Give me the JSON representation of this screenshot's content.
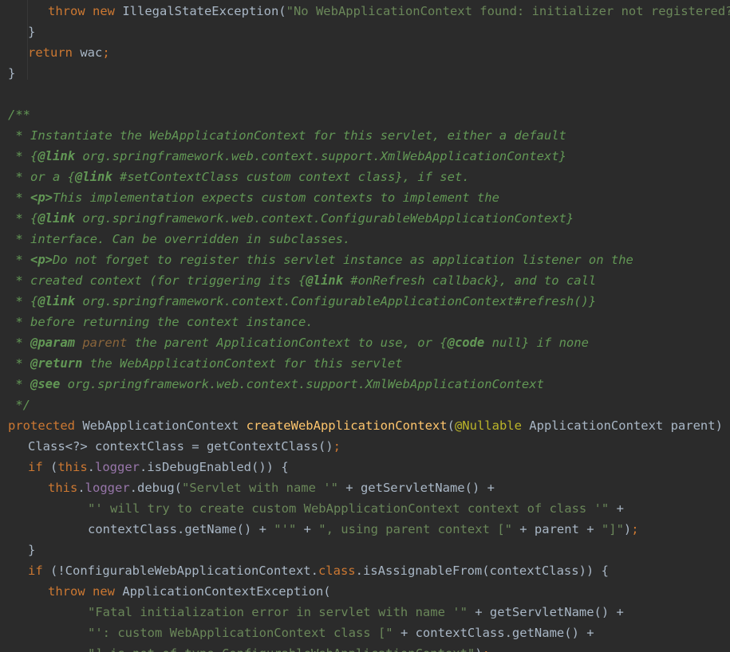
{
  "editor": {
    "language": "Java",
    "theme_colors": {
      "background": "#2b2b2b",
      "keyword": "#cc7832",
      "plain": "#a9b7c6",
      "string": "#6a8759",
      "method_declaration": "#ffc66d",
      "field": "#9876aa",
      "annotation": "#bbb529",
      "doc_comment": "#629755",
      "doc_param": "#8a653b"
    },
    "lines": [
      {
        "indent": 2,
        "tokens": [
          {
            "t": "kw",
            "v": "throw new "
          },
          {
            "t": "plain",
            "v": "IllegalStateException("
          },
          {
            "t": "str",
            "v": "\"No WebApplicationContext found: initializer not registered?\""
          },
          {
            "t": "plain",
            "v": ");"
          }
        ]
      },
      {
        "indent": 1,
        "tokens": [
          {
            "t": "plain",
            "v": "}"
          }
        ]
      },
      {
        "indent": 1,
        "tokens": [
          {
            "t": "kw",
            "v": "return "
          },
          {
            "t": "plain",
            "v": "wac"
          },
          {
            "t": "kw",
            "v": ";"
          }
        ]
      },
      {
        "indent": 0,
        "tokens": [
          {
            "t": "plain",
            "v": "}"
          }
        ]
      },
      {
        "indent": 0,
        "tokens": []
      },
      {
        "indent": 0,
        "tokens": [
          {
            "t": "doc",
            "v": "/**"
          }
        ]
      },
      {
        "indent": 0,
        "tokens": [
          {
            "t": "doc",
            "v": " * Instantiate the WebApplicationContext for this servlet, either a default"
          }
        ]
      },
      {
        "indent": 0,
        "tokens": [
          {
            "t": "doc",
            "v": " * {"
          },
          {
            "t": "doctag",
            "v": "@link"
          },
          {
            "t": "doclink",
            "v": " org.springframework.web.context.support.XmlWebApplicationContext}"
          }
        ]
      },
      {
        "indent": 0,
        "tokens": [
          {
            "t": "doc",
            "v": " * or a {"
          },
          {
            "t": "doctag",
            "v": "@link"
          },
          {
            "t": "doc",
            "v": " #setContextClass custom context class}, if set."
          }
        ]
      },
      {
        "indent": 0,
        "tokens": [
          {
            "t": "doc",
            "v": " * "
          },
          {
            "t": "doctag",
            "v": "<p>"
          },
          {
            "t": "doc",
            "v": "This implementation expects custom contexts to implement the"
          }
        ]
      },
      {
        "indent": 0,
        "tokens": [
          {
            "t": "doc",
            "v": " * {"
          },
          {
            "t": "doctag",
            "v": "@link"
          },
          {
            "t": "doclink",
            "v": " org.springframework.web.context.ConfigurableWebApplicationContext}"
          }
        ]
      },
      {
        "indent": 0,
        "tokens": [
          {
            "t": "doc",
            "v": " * interface. Can be overridden in subclasses."
          }
        ]
      },
      {
        "indent": 0,
        "tokens": [
          {
            "t": "doc",
            "v": " * "
          },
          {
            "t": "doctag",
            "v": "<p>"
          },
          {
            "t": "doc",
            "v": "Do not forget to register this servlet instance as application listener on the"
          }
        ]
      },
      {
        "indent": 0,
        "tokens": [
          {
            "t": "doc",
            "v": " * created context (for triggering its {"
          },
          {
            "t": "doctag",
            "v": "@link"
          },
          {
            "t": "doc",
            "v": " #onRefresh callback}, and to call"
          }
        ]
      },
      {
        "indent": 0,
        "tokens": [
          {
            "t": "doc",
            "v": " * {"
          },
          {
            "t": "doctag",
            "v": "@link"
          },
          {
            "t": "doclink",
            "v": " org.springframework.context.ConfigurableApplicationContext#refresh()}"
          }
        ]
      },
      {
        "indent": 0,
        "tokens": [
          {
            "t": "doc",
            "v": " * before returning the context instance."
          }
        ]
      },
      {
        "indent": 0,
        "tokens": [
          {
            "t": "doc",
            "v": " * "
          },
          {
            "t": "doctag",
            "v": "@param"
          },
          {
            "t": "docparam",
            "v": " parent"
          },
          {
            "t": "doc",
            "v": " the parent ApplicationContext to use, or {"
          },
          {
            "t": "doctag",
            "v": "@code"
          },
          {
            "t": "doc",
            "v": " null} if none"
          }
        ]
      },
      {
        "indent": 0,
        "tokens": [
          {
            "t": "doc",
            "v": " * "
          },
          {
            "t": "doctag",
            "v": "@return"
          },
          {
            "t": "doc",
            "v": " the WebApplicationContext for this servlet"
          }
        ]
      },
      {
        "indent": 0,
        "tokens": [
          {
            "t": "doc",
            "v": " * "
          },
          {
            "t": "doctag",
            "v": "@see"
          },
          {
            "t": "doclink",
            "v": " org.springframework.web.context.support.XmlWebApplicationContext"
          }
        ]
      },
      {
        "indent": 0,
        "tokens": [
          {
            "t": "doc",
            "v": " */"
          }
        ]
      },
      {
        "indent": 0,
        "tokens": [
          {
            "t": "kw",
            "v": "protected "
          },
          {
            "t": "plain",
            "v": "WebApplicationContext "
          },
          {
            "t": "fn",
            "v": "createWebApplicationContext"
          },
          {
            "t": "plain",
            "v": "("
          },
          {
            "t": "ann",
            "v": "@Nullable "
          },
          {
            "t": "plain",
            "v": "ApplicationContext parent) {"
          }
        ]
      },
      {
        "indent": 1,
        "tokens": [
          {
            "t": "plain",
            "v": "Class<?> contextClass = getContextClass()"
          },
          {
            "t": "kw",
            "v": ";"
          }
        ]
      },
      {
        "indent": 1,
        "tokens": [
          {
            "t": "kw",
            "v": "if "
          },
          {
            "t": "plain",
            "v": "("
          },
          {
            "t": "kw",
            "v": "this"
          },
          {
            "t": "plain",
            "v": "."
          },
          {
            "t": "field",
            "v": "logger"
          },
          {
            "t": "plain",
            "v": ".isDebugEnabled()) {"
          }
        ]
      },
      {
        "indent": 2,
        "tokens": [
          {
            "t": "kw",
            "v": "this"
          },
          {
            "t": "plain",
            "v": "."
          },
          {
            "t": "field",
            "v": "logger"
          },
          {
            "t": "plain",
            "v": ".debug("
          },
          {
            "t": "str",
            "v": "\"Servlet with name '\""
          },
          {
            "t": "plain",
            "v": " + getServletName() +"
          }
        ]
      },
      {
        "indent": 4,
        "tokens": [
          {
            "t": "str",
            "v": "\"' will try to create custom WebApplicationContext context of class '\""
          },
          {
            "t": "plain",
            "v": " +"
          }
        ]
      },
      {
        "indent": 4,
        "tokens": [
          {
            "t": "plain",
            "v": "contextClass.getName() + "
          },
          {
            "t": "str",
            "v": "\"'\""
          },
          {
            "t": "plain",
            "v": " + "
          },
          {
            "t": "str",
            "v": "\", using parent context [\""
          },
          {
            "t": "plain",
            "v": " + parent + "
          },
          {
            "t": "str",
            "v": "\"]\""
          },
          {
            "t": "plain",
            "v": ")"
          },
          {
            "t": "kw",
            "v": ";"
          }
        ]
      },
      {
        "indent": 1,
        "tokens": [
          {
            "t": "plain",
            "v": "}"
          }
        ]
      },
      {
        "indent": 1,
        "tokens": [
          {
            "t": "kw",
            "v": "if "
          },
          {
            "t": "plain",
            "v": "(!ConfigurableWebApplicationContext."
          },
          {
            "t": "kw",
            "v": "class"
          },
          {
            "t": "plain",
            "v": ".isAssignableFrom(contextClass)) {"
          }
        ]
      },
      {
        "indent": 2,
        "tokens": [
          {
            "t": "kw",
            "v": "throw new "
          },
          {
            "t": "plain",
            "v": "ApplicationContextException("
          }
        ]
      },
      {
        "indent": 4,
        "tokens": [
          {
            "t": "str",
            "v": "\"Fatal initialization error in servlet with name '\""
          },
          {
            "t": "plain",
            "v": " + getServletName() +"
          }
        ]
      },
      {
        "indent": 4,
        "tokens": [
          {
            "t": "str",
            "v": "\"': custom WebApplicationContext class [\""
          },
          {
            "t": "plain",
            "v": " + contextClass.getName() +"
          }
        ]
      },
      {
        "indent": 4,
        "tokens": [
          {
            "t": "str",
            "v": "\"] is not of type ConfigurableWebApplicationContext\""
          },
          {
            "t": "plain",
            "v": ")"
          },
          {
            "t": "kw",
            "v": ";"
          }
        ]
      }
    ]
  }
}
